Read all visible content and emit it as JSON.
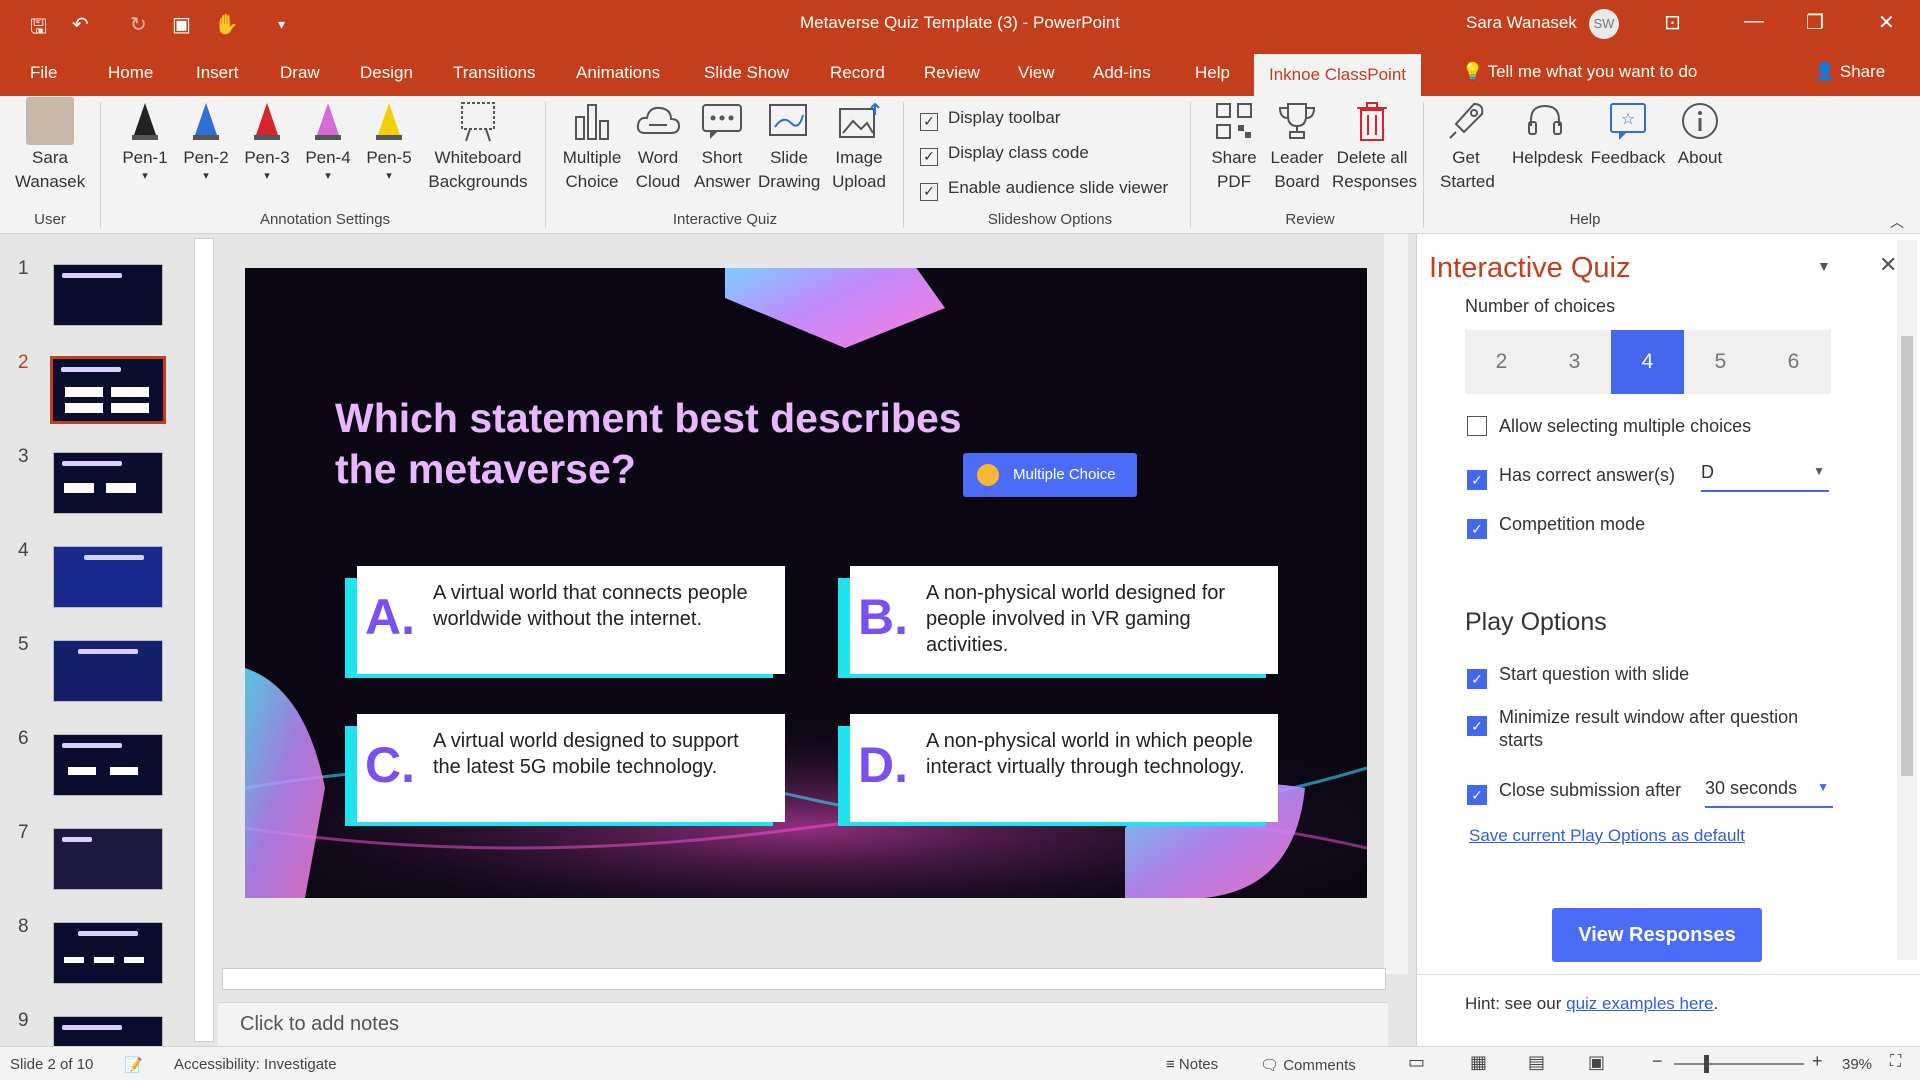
{
  "app": {
    "title": "Metaverse Quiz Template (3)  -  PowerPoint",
    "user": "Sara Wanasek",
    "initials": "SW"
  },
  "tabs": [
    "File",
    "Home",
    "Insert",
    "Draw",
    "Design",
    "Transitions",
    "Animations",
    "Slide Show",
    "Record",
    "Review",
    "View",
    "Add-ins",
    "Help"
  ],
  "active_tab": "Inknoe ClassPoint",
  "tell_me": "Tell me what you want to do",
  "share": "Share",
  "ribbon": {
    "user_btn": "Sara Wanasek",
    "pens": [
      "Pen-1",
      "Pen-2",
      "Pen-3",
      "Pen-4",
      "Pen-5"
    ],
    "pen_colors": [
      "#222222",
      "#2f6fd6",
      "#d9232d",
      "#d46bd6",
      "#f0d000"
    ],
    "whiteboard": "Whiteboard Backgrounds",
    "quiz_btns": [
      "Multiple Choice",
      "Word Cloud",
      "Short Answer",
      "Slide Drawing",
      "Image Upload"
    ],
    "slideshow_opts": [
      "Display toolbar",
      "Display class code",
      "Enable audience slide viewer"
    ],
    "review_btns": [
      "Share PDF",
      "Leader Board",
      "Delete all Responses"
    ],
    "help_btns": [
      "Get Started",
      "Helpdesk",
      "Feedback",
      "About"
    ],
    "groups": {
      "user": "User",
      "annotation": "Annotation Settings",
      "quiz": "Interactive Quiz",
      "slideshow": "Slideshow Options",
      "review": "Review",
      "help": "Help"
    }
  },
  "thumbnails": [
    "1",
    "2",
    "3",
    "4",
    "5",
    "6",
    "7",
    "8",
    "9"
  ],
  "slide": {
    "question": "Which statement best describes the metaverse?",
    "badge": "Multiple Choice",
    "answers": [
      {
        "letter": "A.",
        "text": "A virtual world that connects people worldwide without the internet."
      },
      {
        "letter": "B.",
        "text": "A non-physical world designed for people involved in VR gaming activities."
      },
      {
        "letter": "C.",
        "text": "A virtual world designed to support the latest 5G mobile technology."
      },
      {
        "letter": "D.",
        "text": "A non-physical world in which people interact virtually through technology."
      }
    ]
  },
  "notes_placeholder": "Click to add notes",
  "pane": {
    "title": "Interactive Quiz",
    "num_choices_label": "Number of choices",
    "choices": [
      "2",
      "3",
      "4",
      "5",
      "6"
    ],
    "selected_choice": "4",
    "allow_multiple": "Allow selecting multiple choices",
    "has_correct": "Has correct answer(s)",
    "correct_value": "D",
    "competition": "Competition mode",
    "play_options": "Play Options",
    "start_with_slide": "Start question with slide",
    "minimize": "Minimize result window after question starts",
    "close_after": "Close submission after",
    "close_value": "30 seconds",
    "save_default": "Save current Play Options as default",
    "view_responses": "View Responses",
    "hint_prefix": "Hint: see our ",
    "hint_link": "quiz examples here",
    "hint_suffix": "."
  },
  "status": {
    "slide": "Slide 2 of 10",
    "accessibility": "Accessibility: Investigate",
    "notes": "Notes",
    "comments": "Comments",
    "zoom": "39%"
  }
}
